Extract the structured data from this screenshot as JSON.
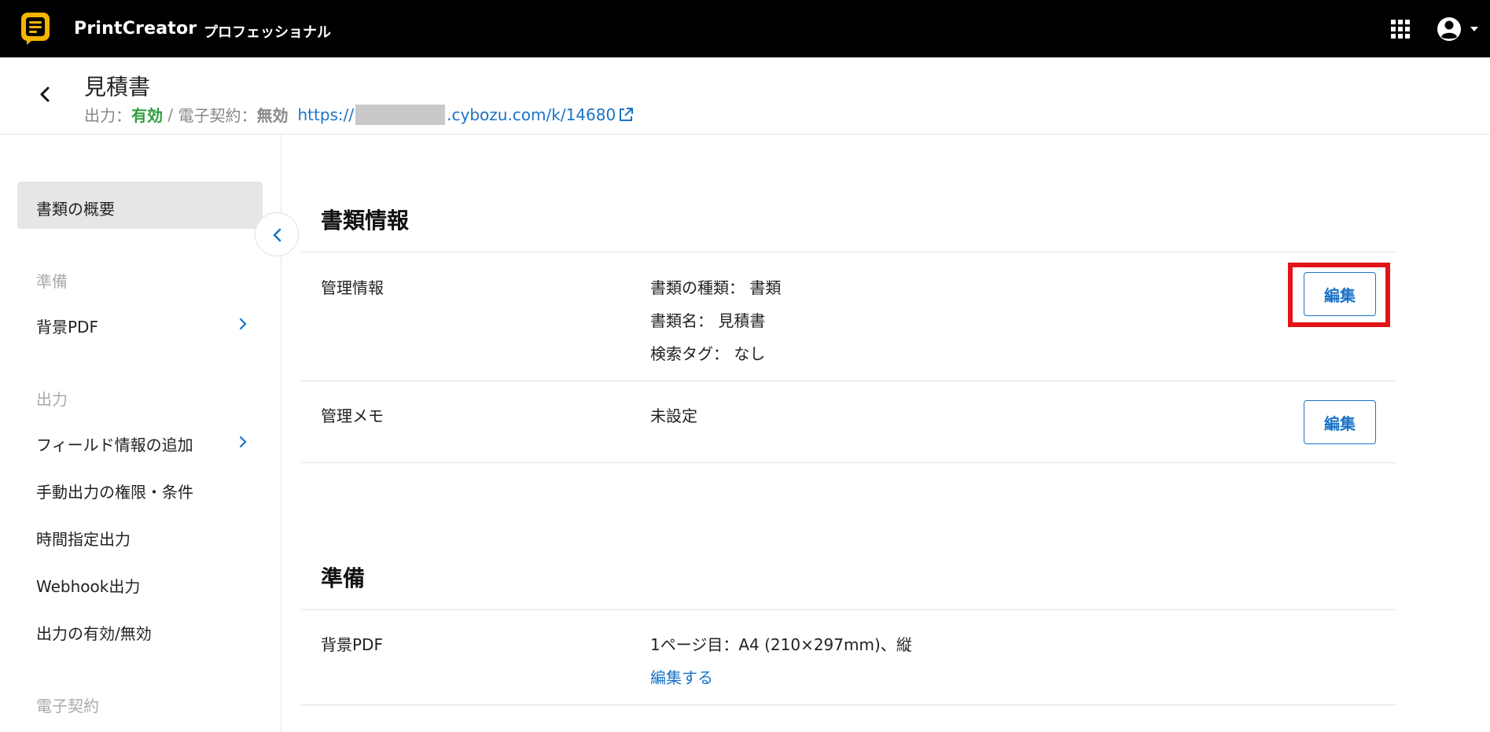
{
  "app": {
    "name": "PrintCreator",
    "plan": "プロフェッショナル"
  },
  "page": {
    "title": "見積書",
    "output_label": "出力：",
    "output_value": "有効",
    "separator": " / ",
    "esign_label": "電子契約：",
    "esign_value": "無効",
    "link_prefix": "https://",
    "link_suffix": ".cybozu.com/k/14680"
  },
  "sidebar": {
    "active_item": "書類の概要",
    "sections": {
      "prep": "準備",
      "output": "出力",
      "esign": "電子契約"
    },
    "items": {
      "background_pdf": "背景PDF",
      "field_info": "フィールド情報の追加",
      "manual_output": "手動出力の権限・条件",
      "scheduled_output": "時間指定出力",
      "webhook_output": "Webhook出力",
      "output_toggle": "出力の有効/無効"
    }
  },
  "main": {
    "doc_info": {
      "title": "書類情報",
      "management": {
        "label": "管理情報",
        "doc_type": "書類の種類： 書類",
        "doc_name": "書類名： 見積書",
        "search_tag": "検索タグ： なし",
        "edit": "編集"
      },
      "memo": {
        "label": "管理メモ",
        "value": "未設定",
        "edit": "編集"
      }
    },
    "prep": {
      "title": "準備",
      "background_pdf": {
        "label": "背景PDF",
        "value": "1ページ目：A4 (210×297mm)、縦",
        "edit_link": "編集する"
      }
    }
  },
  "colors": {
    "topbar": "#000000",
    "accent": "#1a73c7",
    "enabled": "#2e9e3e",
    "highlight": "#e3131a",
    "logo": "#f5b400"
  }
}
